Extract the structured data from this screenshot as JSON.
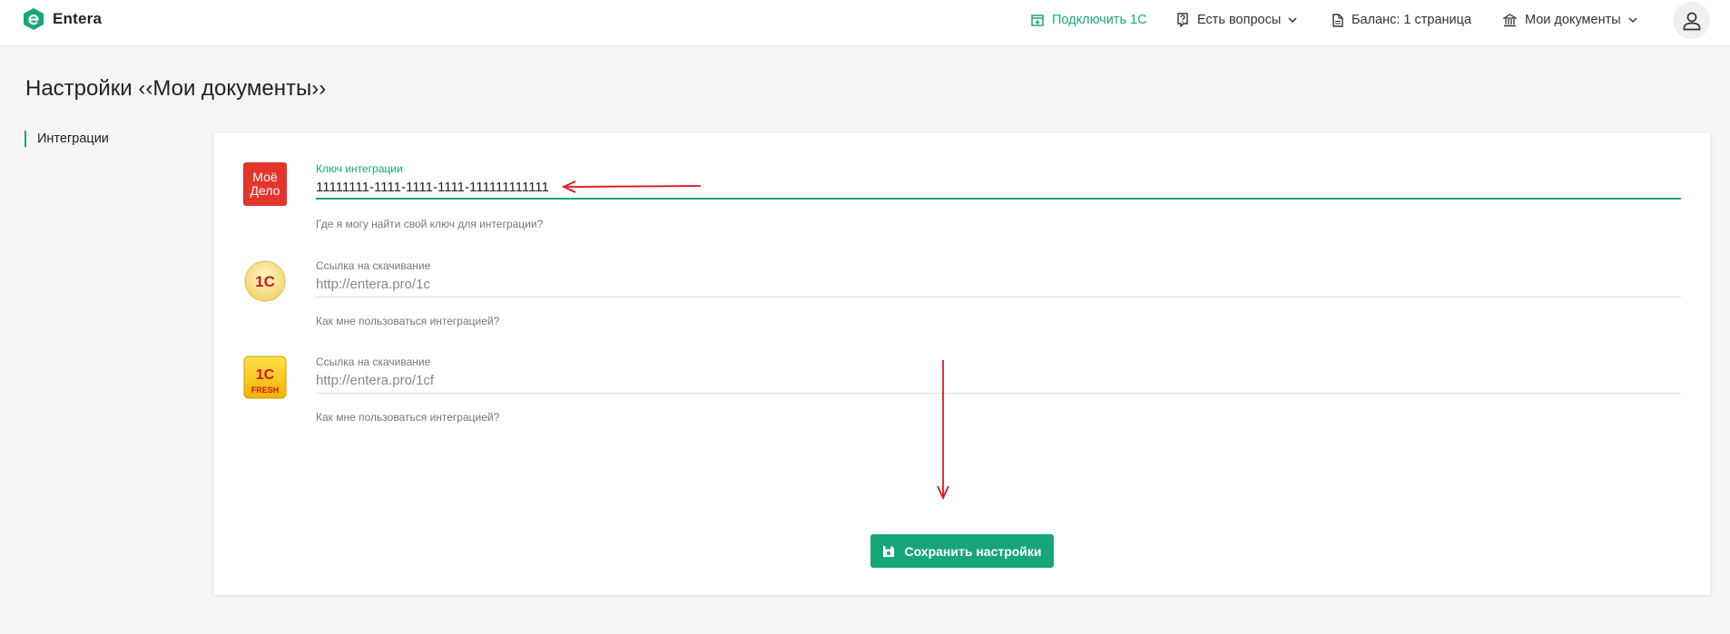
{
  "header": {
    "brand": "Entera",
    "nav": {
      "connect": "Подключить 1С",
      "questions": "Есть вопросы",
      "balance": "Баланс: 1 страница",
      "documents": "Мои документы"
    }
  },
  "page": {
    "title": "Настройки ‹‹Мои документы››"
  },
  "sidebar": {
    "items": [
      {
        "label": "Интеграции"
      }
    ]
  },
  "integrations": [
    {
      "logo_text": [
        "Моё",
        "Дело"
      ],
      "label": "Ключ интеграции",
      "value": "11111111-1111-1111-1111-111111111111",
      "help": "Где я могу найти свой ключ для интеграции?"
    },
    {
      "logo_text": "1С",
      "label": "Ссылка на скачивание",
      "value": "http://entera.pro/1c",
      "help": "Как мне пользоваться интеграцией?"
    },
    {
      "logo_text": [
        "1С",
        "FRESH"
      ],
      "label": "Ссылка на скачивание",
      "value": "http://entera.pro/1cf",
      "help": "Как мне пользоваться интеграцией?"
    }
  ],
  "actions": {
    "save_label": "Сохранить настройки"
  },
  "colors": {
    "accent": "#17a67a",
    "moe_delo_red": "#e4352b",
    "annotation_arrow": "#e0161e"
  }
}
